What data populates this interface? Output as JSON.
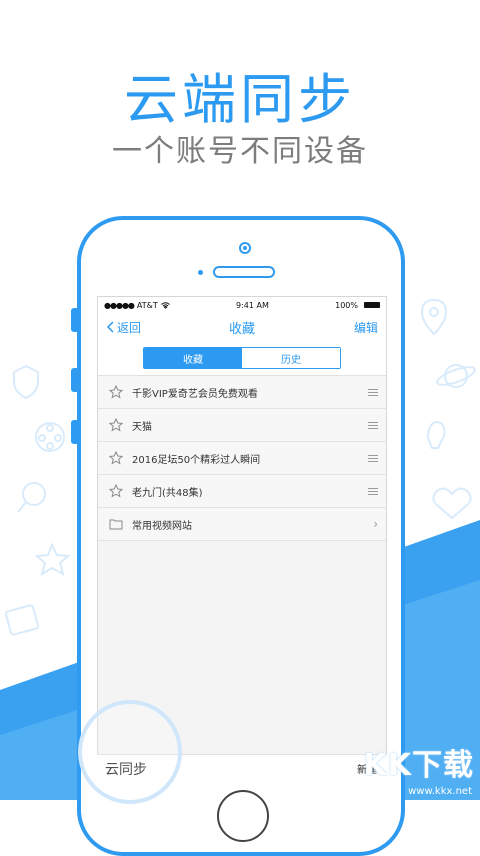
{
  "headline": "云端同步",
  "subline": "一个账号不同设备",
  "status": {
    "carrier": "AT&T",
    "time": "9:41 AM",
    "battery": "100%"
  },
  "nav": {
    "back": "返回",
    "title": "收藏",
    "edit": "编辑"
  },
  "tabs": [
    {
      "label": "收藏",
      "active": true
    },
    {
      "label": "历史",
      "active": false
    }
  ],
  "rows": [
    {
      "label": "千影VIP爱奇艺会员免费观看",
      "icon": "star-icon"
    },
    {
      "label": "天猫",
      "icon": "star-icon"
    },
    {
      "label": "2016足坛50个精彩过人瞬间",
      "icon": "star-icon"
    },
    {
      "label": "老九门(共48集)",
      "icon": "star-icon"
    },
    {
      "label": "常用视频网站",
      "icon": "folder-icon"
    }
  ],
  "bottom": {
    "left": "云同步",
    "right": "新建"
  },
  "watermark": {
    "text": "KK下载",
    "url": "www.kkx.net"
  },
  "colors": {
    "accent": "#2c9af0",
    "band": "#4aa8f2"
  }
}
